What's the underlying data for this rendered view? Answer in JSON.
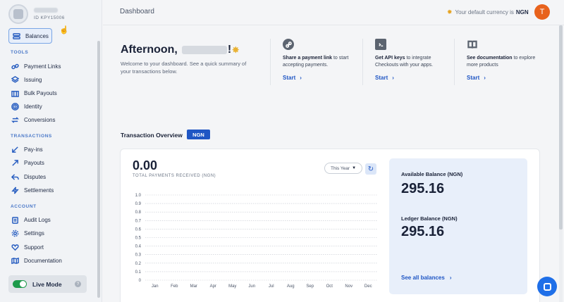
{
  "profile": {
    "id_text": "ID KPY15006"
  },
  "sidebar": {
    "balances_label": "Balances",
    "sections": [
      {
        "title": "TOOLS",
        "items": [
          "Payment Links",
          "Issuing",
          "Bulk Payouts",
          "Identity",
          "Conversions"
        ]
      },
      {
        "title": "TRANSACTIONS",
        "items": [
          "Pay-ins",
          "Payouts",
          "Disputes",
          "Settlements"
        ]
      },
      {
        "title": "ACCOUNT",
        "items": [
          "Audit Logs",
          "Settings",
          "Support",
          "Documentation"
        ]
      }
    ],
    "live_mode_label": "Live Mode",
    "live_mode_on": true
  },
  "header": {
    "title": "Dashboard",
    "currency_note": "Your default currency is",
    "currency_code": "NGN",
    "user_initial": "T"
  },
  "greeting": {
    "prefix": "Afternoon,",
    "subtitle": "Welcome to your dashboard. See a quick summary of your transactions below."
  },
  "quick_links": [
    {
      "icon": "link-icon",
      "bold": "Share a payment link",
      "rest": " to start accepting payments.",
      "cta": "Start"
    },
    {
      "icon": "terminal-icon",
      "bold": "Get API keys",
      "rest": " to integrate Checkouts with your apps.",
      "cta": "Start"
    },
    {
      "icon": "book-icon",
      "bold": "See documentation",
      "rest": " to explore more products",
      "cta": "Start"
    }
  ],
  "overview": {
    "title": "Transaction Overview",
    "currency_badge": "NGN",
    "total_value": "0.00",
    "total_label": "TOTAL PAYMENTS RECEIVED (NGN)",
    "period": "This Year"
  },
  "balances": {
    "available_label": "Available Balance (NGN)",
    "available_value": "295.16",
    "ledger_label": "Ledger Balance (NGN)",
    "ledger_value": "295.16",
    "see_all": "See all balances"
  },
  "colors": {
    "accent": "#1f56c4",
    "avatar": "#e8621c",
    "live": "#1d9a4b"
  },
  "chart_data": {
    "type": "bar",
    "categories": [
      "Jan",
      "Feb",
      "Mar",
      "Apr",
      "May",
      "Jun",
      "Jul",
      "Aug",
      "Sep",
      "Oct",
      "Nov",
      "Dec"
    ],
    "values": [
      0,
      0,
      0,
      0,
      0,
      0,
      0,
      0,
      0,
      0,
      0,
      0
    ],
    "yticks": [
      "1.0",
      "0.9",
      "0.8",
      "0.7",
      "0.6",
      "0.5",
      "0.4",
      "0.3",
      "0.2",
      "0.1",
      "0"
    ],
    "ylim": [
      0,
      1
    ],
    "grid": true
  }
}
